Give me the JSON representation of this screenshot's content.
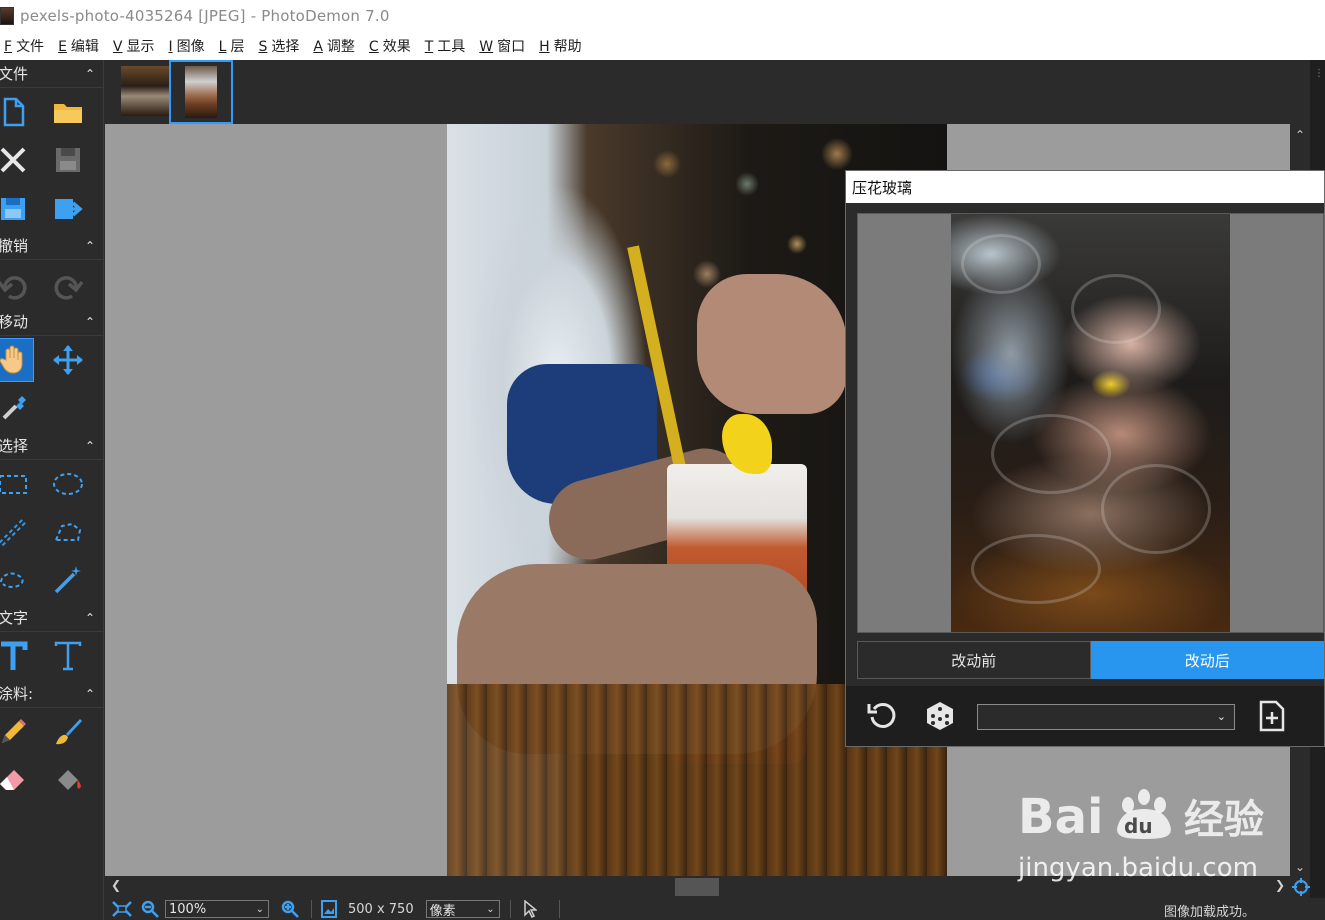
{
  "window": {
    "title": "pexels-photo-4035264 [JPEG]  -  PhotoDemon 7.0"
  },
  "menu": [
    {
      "key": "F",
      "label": "文件"
    },
    {
      "key": "E",
      "label": "编辑"
    },
    {
      "key": "V",
      "label": "显示"
    },
    {
      "key": "I",
      "label": "图像"
    },
    {
      "key": "L",
      "label": "层"
    },
    {
      "key": "S",
      "label": "选择"
    },
    {
      "key": "A",
      "label": "调整"
    },
    {
      "key": "C",
      "label": "效果"
    },
    {
      "key": "T",
      "label": "工具"
    },
    {
      "key": "W",
      "label": "窗口"
    },
    {
      "key": "H",
      "label": "帮助"
    }
  ],
  "toolbox": {
    "sections": {
      "file": "文件",
      "undo": "撤销",
      "move": "移动",
      "select": "选择",
      "text": "文字",
      "paint": "涂料:"
    }
  },
  "dialog": {
    "title": "压花玻璃",
    "before_label": "改动前",
    "after_label": "改动后",
    "active_view": "after",
    "preset_value": ""
  },
  "statusbar": {
    "zoom": "100%",
    "size": "500 x 750",
    "unit": "像素",
    "message": "图像加载成功。"
  },
  "watermark": {
    "url": "jingyan.baidu.com"
  },
  "colors": {
    "accent": "#2896ee",
    "tool_active": "#1a6fc4",
    "panel_bg": "#2b2b2b",
    "canvas_bg": "#9c9c9c"
  }
}
